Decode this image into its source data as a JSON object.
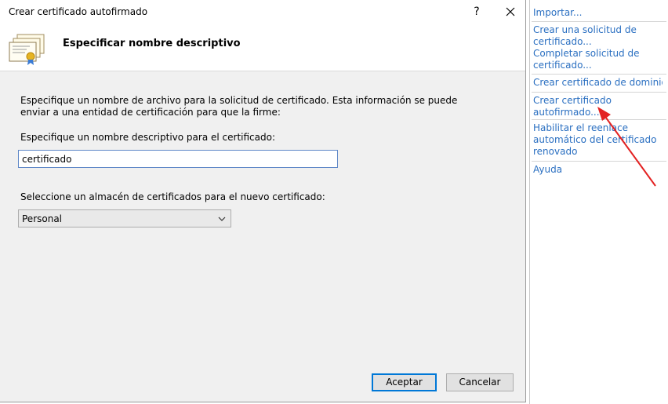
{
  "dialog": {
    "title": "Crear certificado autofirmado",
    "help_label": "?",
    "header_title": "Especificar nombre descriptivo",
    "description": "Especifique un nombre de archivo para la solicitud de certificado. Esta información se puede enviar a una entidad de certificación para que la firme:",
    "name_label": "Especifique un nombre descriptivo para el certificado:",
    "name_value": "certificado",
    "store_label": "Seleccione un almacén de certificados para el nuevo certificado:",
    "store_value": "Personal",
    "ok_label": "Aceptar",
    "cancel_label": "Cancelar"
  },
  "actions": {
    "import": "Importar...",
    "create_request": "Crear una solicitud de certificado...",
    "complete_request": "Completar solicitud de certificado...",
    "domain_cert": "Crear certificado de dominio...",
    "self_signed": "Crear certificado autofirmado...",
    "renew": "Habilitar el reenlace automático del certificado renovado",
    "help": "Ayuda"
  },
  "colors": {
    "link": "#2a6fc1",
    "annotation_arrow": "#e32222",
    "focus_border": "#0078d7"
  },
  "icons": [
    "certificate-icon",
    "close-icon",
    "chevron-down-icon"
  ]
}
